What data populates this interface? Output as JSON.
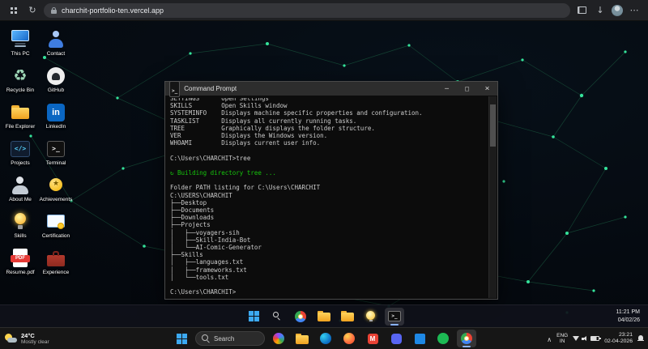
{
  "browser": {
    "url": "charchit-portfolio-ten.vercel.app"
  },
  "desktop_icons": [
    {
      "label": "This PC",
      "icon": "computer"
    },
    {
      "label": "Contact",
      "icon": "contact"
    },
    {
      "label": "Recycle Bin",
      "icon": "recycle"
    },
    {
      "label": "GitHub",
      "icon": "github"
    },
    {
      "label": "File Explorer",
      "icon": "folder"
    },
    {
      "label": "LinkedIn",
      "icon": "linkedin"
    },
    {
      "label": "Projects",
      "icon": "code"
    },
    {
      "label": "Terminal",
      "icon": "terminal"
    },
    {
      "label": "About Me",
      "icon": "person"
    },
    {
      "label": "Achievements",
      "icon": "trophy"
    },
    {
      "label": "Skills",
      "icon": "lightbulb"
    },
    {
      "label": "Certification",
      "icon": "certificate"
    },
    {
      "label": "Resume.pdf",
      "icon": "pdf"
    },
    {
      "label": "Experience",
      "icon": "briefcase"
    }
  ],
  "cmd": {
    "title": "Command Prompt",
    "lines": [
      {
        "text": "SETTINGS      Open Settings",
        "style": "clipped"
      },
      {
        "text": "SKILLS        Open Skills window"
      },
      {
        "text": "SYSTEMINFO    Displays machine specific properties and configuration."
      },
      {
        "text": "TASKLIST      Displays all currently running tasks."
      },
      {
        "text": "TREE          Graphically displays the folder structure."
      },
      {
        "text": "VER           Displays the Windows version."
      },
      {
        "text": "WHOAMI        Displays current user info."
      },
      {
        "text": ""
      },
      {
        "text": "C:\\Users\\CHARCHIT>tree"
      },
      {
        "text": ""
      },
      {
        "text": "Building directory tree ...",
        "style": "green",
        "spinner": true
      },
      {
        "text": ""
      },
      {
        "text": "Folder PATH listing for C:\\Users\\CHARCHIT"
      },
      {
        "text": "C:\\USERS\\CHARCHIT"
      },
      {
        "text": "├──Desktop"
      },
      {
        "text": "├──Documents"
      },
      {
        "text": "├──Downloads"
      },
      {
        "text": "├──Projects"
      },
      {
        "text": "│   ├──voyagers-sih"
      },
      {
        "text": "│   ├──Skill-India-Bot"
      },
      {
        "text": "│   └──AI-Comic-Generator"
      },
      {
        "text": "├──Skills"
      },
      {
        "text": "│   ├──languages.txt"
      },
      {
        "text": "│   ├──frameworks.txt"
      },
      {
        "text": "│   └──tools.txt"
      },
      {
        "text": ""
      },
      {
        "text": "C:\\Users\\CHARCHIT>"
      }
    ]
  },
  "fake_taskbar": {
    "icons": [
      {
        "name": "start"
      },
      {
        "name": "search"
      },
      {
        "name": "chrome"
      },
      {
        "name": "folder"
      },
      {
        "name": "folder"
      },
      {
        "name": "lightbulb"
      },
      {
        "name": "terminal",
        "active": true
      }
    ],
    "time": "11:21 PM",
    "date": "04/02/26"
  },
  "taskbar": {
    "weather_temp": "24°C",
    "weather_desc": "Mostly clear",
    "search_label": "Search",
    "apps": [
      {
        "name": "copilot"
      },
      {
        "name": "folder"
      },
      {
        "name": "edge"
      },
      {
        "name": "firefox"
      },
      {
        "name": "gmail"
      },
      {
        "name": "discord"
      },
      {
        "name": "vscode"
      },
      {
        "name": "spotify"
      },
      {
        "name": "chrome",
        "active": true
      }
    ],
    "tray": {
      "lang": "ENG",
      "region": "IN",
      "time": "23:21",
      "date": "02-04-2026"
    }
  },
  "colors": {
    "accent_green": "#16c60c",
    "constellation": "#35e39b",
    "taskbar_bg": "#161616"
  }
}
